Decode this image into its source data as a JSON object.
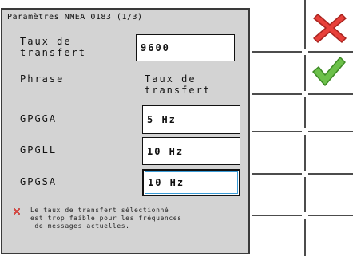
{
  "dialog": {
    "title": "Paramètres NMEA 0183 (1/3)",
    "baud_label_line1": "Taux de",
    "baud_label_line2": "transfert",
    "baud_value": "9600",
    "col_sentence": "Phrase",
    "col_rate_line1": "Taux de",
    "col_rate_line2": "transfert",
    "rows": [
      {
        "sentence": "GPGGA",
        "rate": "5 Hz"
      },
      {
        "sentence": "GPGLL",
        "rate": "10 Hz"
      },
      {
        "sentence": "GPGSA",
        "rate": "10 Hz"
      }
    ],
    "warning_line1": "Le taux de transfert sélectionné",
    "warning_line2": "est trop faible pour les fréquences",
    "warning_line3": "de messages actuelles."
  },
  "actions": {
    "cancel_icon": "red-x-icon",
    "confirm_icon": "green-check-icon"
  },
  "colors": {
    "panel": "#d3d3d3",
    "cancel": "#e8403a",
    "confirm": "#6cc04a",
    "focus": "#3a9bd6"
  }
}
